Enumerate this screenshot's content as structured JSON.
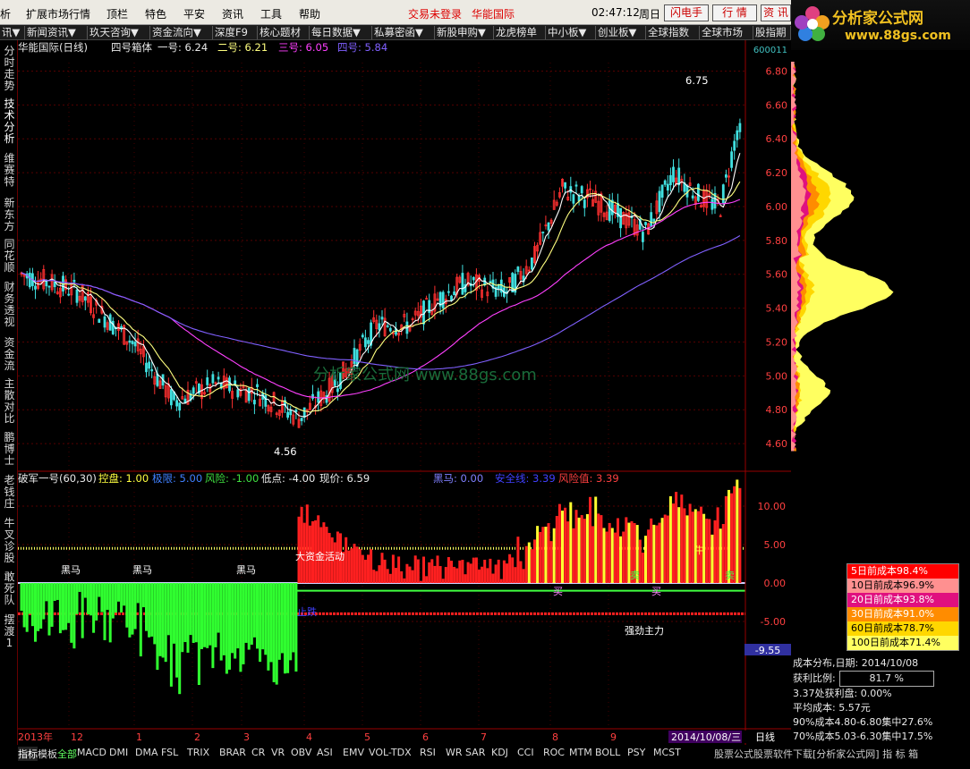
{
  "menu": {
    "items": [
      "析",
      "扩展市场行情",
      "顶栏",
      "特色",
      "平安",
      "资讯",
      "工具",
      "帮助"
    ],
    "login": "交易未登录",
    "broker": "华能国际",
    "time": "02:47:12",
    "weekday": "周日",
    "btn_flash": "闪电手",
    "btn_quote": "行  情",
    "btn_info": "资  讯"
  },
  "nav": {
    "items": [
      "讯▼",
      "新闻资讯▼",
      "玖天咨询▼",
      "资金流向▼",
      "深度F9",
      "核心题材",
      "每日数据▼",
      "私募密函▼",
      "新股申购▼",
      "龙虎榜单",
      "中小板▼",
      "创业板▼",
      "全球指数",
      "全球市场",
      "股指期"
    ]
  },
  "logo": {
    "title": "分析家公式网",
    "url": "www.88gs.com"
  },
  "sidebar": {
    "items": [
      "分时走势",
      "技术分析",
      "维赛特",
      "新东方",
      "同花顺",
      "财务透视",
      "资金流",
      "主散对比",
      "鹏博士",
      "老钱庄",
      "牛叉诊股",
      "敢死队",
      "摆渡1"
    ]
  },
  "main": {
    "title": "华能国际(日线)",
    "indicator": "四号箱体",
    "l1": "一号: 6.24",
    "l2": "二号: 6.21",
    "l3": "三号: 6.05",
    "l4": "四号: 5.84",
    "hi_label": "6.75",
    "lo_label": "4.56",
    "yticks": [
      "6.80",
      "6.60",
      "6.40",
      "6.20",
      "6.00",
      "5.80",
      "5.60",
      "5.40",
      "5.20",
      "5.00",
      "4.80",
      "4.60"
    ],
    "watermark": "分析家公式网  www.88gs.com",
    "code": "600011"
  },
  "sub": {
    "title": "破军一号(60,30)",
    "kp": "控盘: 1.00",
    "jx": "极限: 5.00",
    "fx": "风险: -1.00",
    "dd": "低点: -4.00",
    "xj": "现价: 6.59",
    "hm": "黑马: 0.00",
    "aqx": "安全线: 3.39",
    "fxz": "风险值: 3.39",
    "yticks": [
      "10.00",
      "5.00",
      "0.00",
      "-5.00"
    ],
    "lowval": "-9.55",
    "ann": {
      "dm": "大资金活动",
      "hm": "黑马",
      "mai": "买",
      "mai2": "卖",
      "qz": "强劲主力",
      "zd": "止跌",
      "xn": "牛"
    }
  },
  "dates": {
    "year": "2013年",
    "m": [
      "12",
      "1",
      "2",
      "3",
      "4",
      "5",
      "6",
      "7",
      "8",
      "9"
    ],
    "cur": "2014/10/08/三",
    "period": "日线"
  },
  "legend": [
    {
      "label": "5日前成本98.4%",
      "color": "#ff0000",
      "text": "#fff"
    },
    {
      "label": "10日前成本96.9%",
      "color": "#ff9090",
      "text": "#000"
    },
    {
      "label": "20日前成本93.8%",
      "color": "#e0107f",
      "text": "#fff"
    },
    {
      "label": "30日前成本91.0%",
      "color": "#ff8c00",
      "text": "#fff"
    },
    {
      "label": "60日前成本78.7%",
      "color": "#ffd700",
      "text": "#000"
    },
    {
      "label": "100日前成本71.4%",
      "color": "#ffff60",
      "text": "#000"
    }
  ],
  "cost": {
    "date_line": "成本分布,日期: 2014/10/08",
    "profit_label": "获利比例:",
    "profit_val": "81.7 %",
    "l3": "3.37处获利盘: 0.00%",
    "avg": "平均成本: 5.57元",
    "c90": "90%成本4.80-6.80集中27.6%",
    "c70": "70%成本5.03-6.30集中17.5%"
  },
  "bottom": {
    "tabs": [
      "指标",
      "模板",
      "全部",
      "MACD",
      "DMI",
      "DMA",
      "FSL",
      "TRIX",
      "BRAR",
      "CR",
      "VR",
      "OBV",
      "ASI",
      "EMV",
      "VOL-TDX",
      "RSI",
      "WR",
      "SAR",
      "KDJ",
      "CCI",
      "ROC",
      "MTM",
      "BOLL",
      "PSY",
      "MCST"
    ],
    "right": "股票公式股票软件下载[分析家公式网] 指 标 箱"
  },
  "chart_data": {
    "type": "candlestick",
    "title": "华能国际(日线)",
    "ylim": [
      4.5,
      6.85
    ],
    "high": 6.75,
    "low": 4.56,
    "ma": {
      "一号": 6.24,
      "二号": 6.21,
      "三号": 6.05,
      "四号": 5.84
    },
    "last_date": "2014/10/08"
  }
}
